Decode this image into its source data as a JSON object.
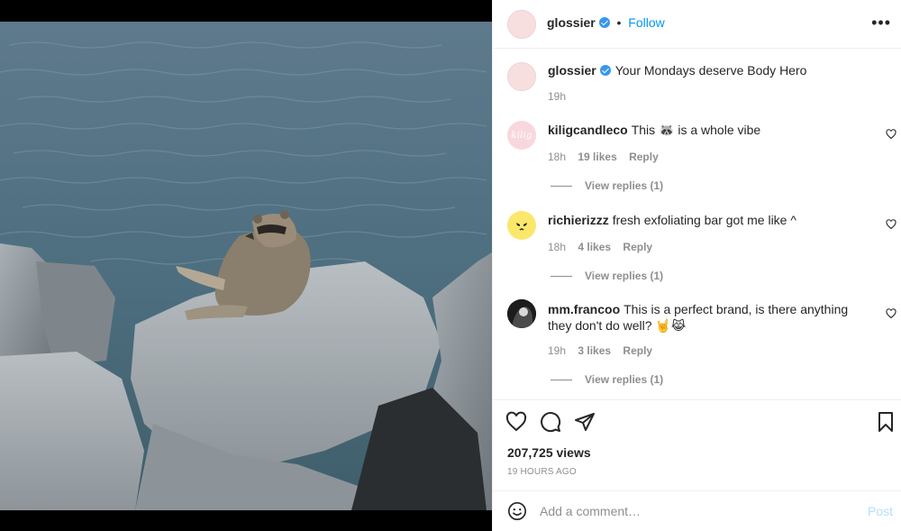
{
  "post": {
    "author": "glossier",
    "follow_label": "Follow",
    "separator": "•",
    "more_label": "•••",
    "media_description": "raccoon sitting on rocks by the water"
  },
  "caption": {
    "username": "glossier",
    "text": "Your Mondays deserve Body Hero",
    "time": "19h"
  },
  "comments": [
    {
      "username": "kiligcandleco",
      "avatar_text": "kilig",
      "text": "This 🦝 is a whole vibe",
      "time": "18h",
      "likes": "19 likes",
      "reply": "Reply",
      "view_replies": "View replies (1)"
    },
    {
      "username": "richierizzz",
      "text": "fresh exfoliating bar got me like ^",
      "time": "18h",
      "likes": "4 likes",
      "reply": "Reply",
      "view_replies": "View replies (1)"
    },
    {
      "username": "mm.francoo",
      "text": "This is a perfect brand, is there anything they don't do well? 🤘😹",
      "time": "19h",
      "likes": "3 likes",
      "reply": "Reply",
      "view_replies": "View replies (1)"
    }
  ],
  "stats": {
    "views": "207,725 views",
    "time_ago": "19 HOURS AGO"
  },
  "comment_bar": {
    "placeholder": "Add a comment…",
    "post_label": "Post"
  },
  "icons": {
    "like": "heart-icon",
    "comment": "comment-icon",
    "share": "paper-plane-icon",
    "save": "bookmark-icon",
    "emoji": "smiley-icon",
    "more": "more-options-icon",
    "verified": "verified-badge-icon"
  },
  "colors": {
    "follow": "#0095f6",
    "verified": "#3897f0",
    "post_disabled": "#b2dffc",
    "muted_text": "#8e8e8e"
  }
}
